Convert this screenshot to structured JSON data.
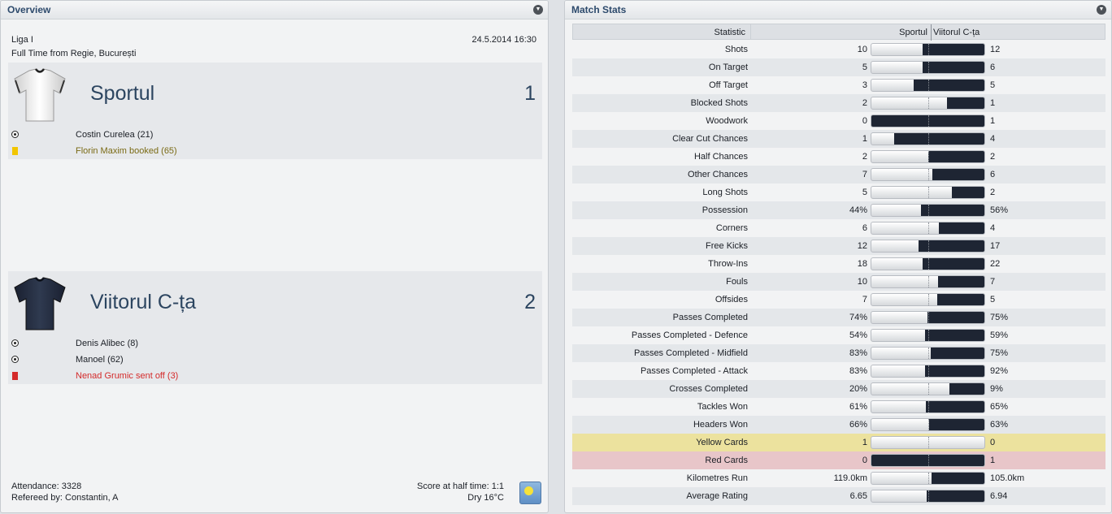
{
  "overview": {
    "title": "Overview",
    "competition": "Liga I",
    "datetime": "24.5.2014 16:30",
    "result_line": "Full Time from Regie, București",
    "home": {
      "name": "Sportul",
      "score": "1",
      "events": [
        {
          "type": "goal",
          "text": "Costin Curelea (21)",
          "color": "#1b1f26"
        },
        {
          "type": "yellow",
          "text": "Florin Maxim booked (65)",
          "color": "#7a6a14"
        }
      ]
    },
    "away": {
      "name": "Viitorul C-ța",
      "score": "2",
      "events": [
        {
          "type": "goal",
          "text": "Denis Alibec (8)",
          "color": "#1b1f26"
        },
        {
          "type": "goal",
          "text": "Manoel (62)",
          "color": "#1b1f26"
        },
        {
          "type": "red",
          "text": "Nenad Grumic sent off (3)",
          "color": "#d42a2a"
        }
      ]
    },
    "attendance": "Attendance: 3328",
    "referee": "Refereed by: Constantin, A",
    "half_time": "Score at half time: 1:1",
    "weather": "Dry 16°C",
    "weather_icon": "sun-icon"
  },
  "stats": {
    "title": "Match Stats",
    "header": {
      "statistic": "Statistic",
      "home": "Sportul",
      "away": "Viitorul C-ța"
    },
    "rows": [
      {
        "label": "Shots",
        "home": "10",
        "away": "12",
        "hv": 10,
        "av": 12
      },
      {
        "label": "On Target",
        "home": "5",
        "away": "6",
        "hv": 5,
        "av": 6
      },
      {
        "label": "Off Target",
        "home": "3",
        "away": "5",
        "hv": 3,
        "av": 5
      },
      {
        "label": "Blocked Shots",
        "home": "2",
        "away": "1",
        "hv": 2,
        "av": 1
      },
      {
        "label": "Woodwork",
        "home": "0",
        "away": "1",
        "hv": 0,
        "av": 1
      },
      {
        "label": "Clear Cut Chances",
        "home": "1",
        "away": "4",
        "hv": 1,
        "av": 4
      },
      {
        "label": "Half Chances",
        "home": "2",
        "away": "2",
        "hv": 2,
        "av": 2
      },
      {
        "label": "Other Chances",
        "home": "7",
        "away": "6",
        "hv": 7,
        "av": 6
      },
      {
        "label": "Long Shots",
        "home": "5",
        "away": "2",
        "hv": 5,
        "av": 2
      },
      {
        "label": "Possession",
        "home": "44%",
        "away": "56%",
        "hv": 44,
        "av": 56
      },
      {
        "label": "Corners",
        "home": "6",
        "away": "4",
        "hv": 6,
        "av": 4
      },
      {
        "label": "Free Kicks",
        "home": "12",
        "away": "17",
        "hv": 12,
        "av": 17
      },
      {
        "label": "Throw-Ins",
        "home": "18",
        "away": "22",
        "hv": 18,
        "av": 22
      },
      {
        "label": "Fouls",
        "home": "10",
        "away": "7",
        "hv": 10,
        "av": 7
      },
      {
        "label": "Offsides",
        "home": "7",
        "away": "5",
        "hv": 7,
        "av": 5
      },
      {
        "label": "Passes Completed",
        "home": "74%",
        "away": "75%",
        "hv": 74,
        "av": 75
      },
      {
        "label": "Passes Completed - Defence",
        "home": "54%",
        "away": "59%",
        "hv": 54,
        "av": 59
      },
      {
        "label": "Passes Completed - Midfield",
        "home": "83%",
        "away": "75%",
        "hv": 83,
        "av": 75
      },
      {
        "label": "Passes Completed - Attack",
        "home": "83%",
        "away": "92%",
        "hv": 83,
        "av": 92
      },
      {
        "label": "Crosses Completed",
        "home": "20%",
        "away": "9%",
        "hv": 20,
        "av": 9
      },
      {
        "label": "Tackles Won",
        "home": "61%",
        "away": "65%",
        "hv": 61,
        "av": 65
      },
      {
        "label": "Headers Won",
        "home": "66%",
        "away": "63%",
        "hv": 66,
        "av": 63
      },
      {
        "label": "Yellow Cards",
        "home": "1",
        "away": "0",
        "hv": 1,
        "av": 0,
        "highlight": "yellow"
      },
      {
        "label": "Red Cards",
        "home": "0",
        "away": "1",
        "hv": 0,
        "av": 1,
        "highlight": "red"
      },
      {
        "label": "Kilometres Run",
        "home": "119.0km",
        "away": "105.0km",
        "hv": 119.0,
        "av": 105.0
      },
      {
        "label": "Average Rating",
        "home": "6.65",
        "away": "6.94",
        "hv": 6.65,
        "av": 6.94
      }
    ]
  }
}
